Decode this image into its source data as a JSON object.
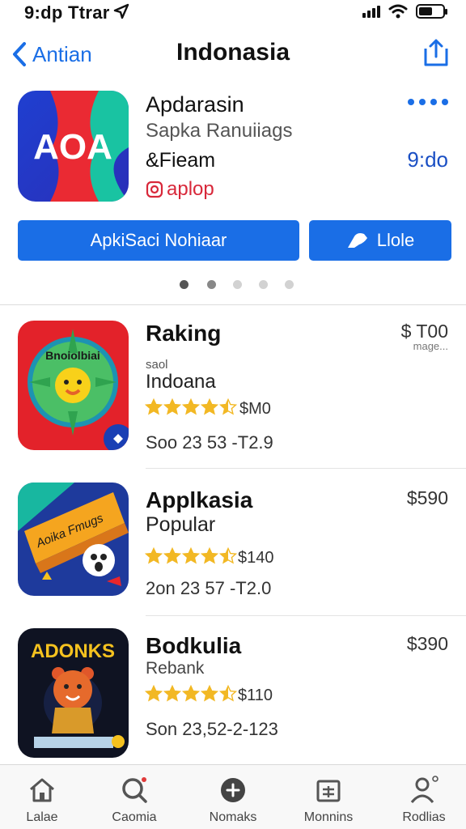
{
  "status": {
    "time": "9:dp Ttrar"
  },
  "nav": {
    "back_label": "Antian",
    "title": "Indonasia"
  },
  "featured": {
    "icon_text": "AOA",
    "title": "Apdarasin",
    "subtitle": "Sapka Ranuiiags",
    "developer": "&Fieam",
    "tag": "aplop",
    "time": "9:do",
    "primary_button": "ApkiSaci Nohiaar",
    "secondary_button": "Llole"
  },
  "pager": {
    "count": 5,
    "active": 0
  },
  "listings": [
    {
      "icon_name": "sun-character-icon",
      "icon_text": "Bnoiolbiai",
      "title": "Raking",
      "sub1": "saol",
      "sub2": "Indoana",
      "rating": 4.5,
      "rating_text": "$M0",
      "footer": "Soo 23 53 -T2.9",
      "price": "$ T00",
      "price_note": "mage..."
    },
    {
      "icon_name": "ticket-ghost-icon",
      "icon_text": "Aoika Fmugs",
      "title": "Applkasia",
      "sub1": "Popular",
      "sub2": "",
      "rating": 4.5,
      "rating_text": "$140",
      "footer": "2on 23 57 -T2.0",
      "price": "$590",
      "price_note": ""
    },
    {
      "icon_name": "bear-character-icon",
      "icon_text": "ADONKS",
      "title": "Bodkulia",
      "sub1": "Rebank",
      "sub2": "",
      "rating": 4.5,
      "rating_text": "$110",
      "footer": "Son 23,52-2-123",
      "price": "$390",
      "price_note": ""
    }
  ],
  "tabs": [
    {
      "label": "Lalae",
      "icon": "home-icon"
    },
    {
      "label": "Caomia",
      "icon": "search-icon"
    },
    {
      "label": "Nomaks",
      "icon": "add-circle-icon"
    },
    {
      "label": "Monnins",
      "icon": "calendar-icon"
    },
    {
      "label": "Rodlias",
      "icon": "profile-icon"
    }
  ],
  "colors": {
    "accent": "#1a6ee6",
    "tag": "#d8283a",
    "star": "#f2b824"
  }
}
